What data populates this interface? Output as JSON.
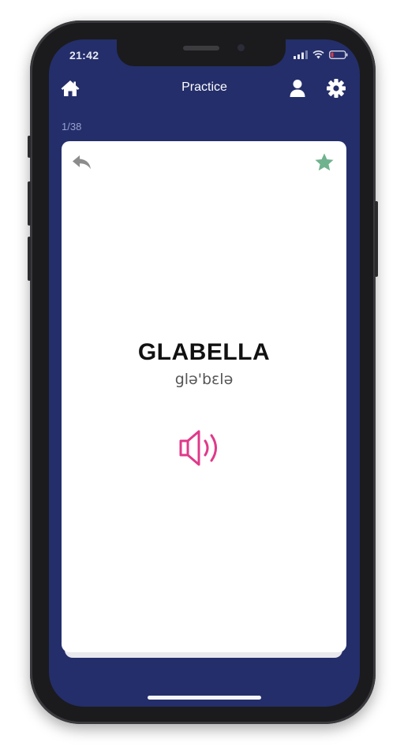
{
  "status_bar": {
    "time": "21:42"
  },
  "navbar": {
    "title": "Practice",
    "home_icon": "home-icon",
    "profile_icon": "user-icon",
    "settings_icon": "gear-icon"
  },
  "progress": {
    "counter": "1/38"
  },
  "card": {
    "word": "GLABELLA",
    "phonetic": "glə'bɛlə",
    "back_icon": "undo-arrow-icon",
    "favorite_icon": "star-icon",
    "audio_icon": "speaker-icon"
  },
  "colors": {
    "app_background": "#242e6a",
    "card_background": "#ffffff",
    "star_accent": "#6fb28e",
    "audio_accent": "#e0398a",
    "back_icon": "#8c8c8c"
  }
}
